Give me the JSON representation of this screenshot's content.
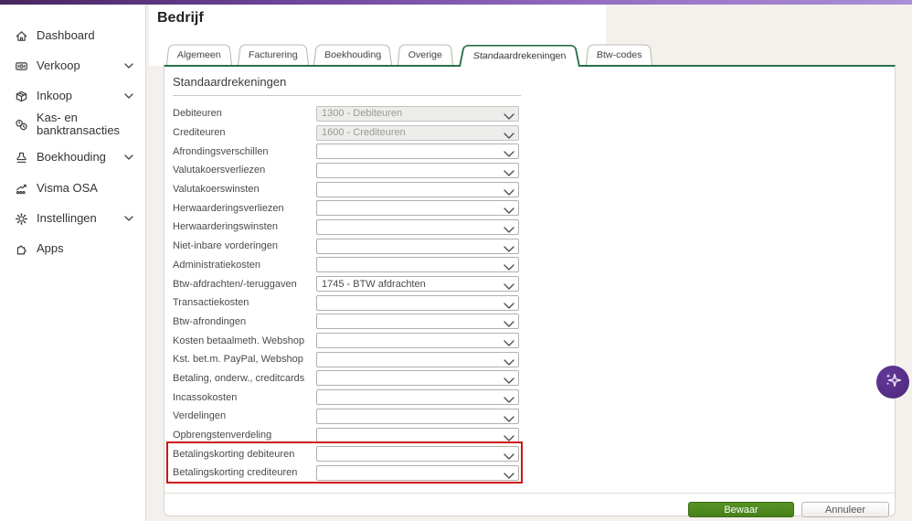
{
  "colors": {
    "topbar_gradient_start": "#46265f",
    "topbar_gradient_end": "#a98fd6",
    "tab_active_green": "#2a7049",
    "save_button_green": "#4c8a1d",
    "highlight_red": "#ce1418",
    "fab_purple": "#552c85"
  },
  "sidebar": {
    "items": [
      {
        "key": "dashboard",
        "label": "Dashboard",
        "icon": "home-icon",
        "chevron": false,
        "two_line": false
      },
      {
        "key": "verkoop",
        "label": "Verkoop",
        "icon": "banknote-icon",
        "chevron": true,
        "two_line": false
      },
      {
        "key": "inkoop",
        "label": "Inkoop",
        "icon": "package-icon",
        "chevron": true,
        "two_line": false
      },
      {
        "key": "kas-en-banktransacties",
        "label": "Kas- en banktransacties",
        "icon": "coins-icon",
        "chevron": false,
        "two_line": true
      },
      {
        "key": "boekhouding",
        "label": "Boekhouding",
        "icon": "stamp-icon",
        "chevron": true,
        "two_line": false
      },
      {
        "key": "visma-osa",
        "label": "Visma OSA",
        "icon": "chart-icon",
        "chevron": false,
        "two_line": false
      },
      {
        "key": "instellingen",
        "label": "Instellingen",
        "icon": "gear-icon",
        "chevron": true,
        "two_line": false
      },
      {
        "key": "apps",
        "label": "Apps",
        "icon": "puzzle-icon",
        "chevron": false,
        "two_line": false
      }
    ]
  },
  "header": {
    "title": "Bedrijf"
  },
  "tabs": [
    {
      "key": "algemeen",
      "label": "Algemeen",
      "active": false
    },
    {
      "key": "facturering",
      "label": "Facturering",
      "active": false
    },
    {
      "key": "boekhouding",
      "label": "Boekhouding",
      "active": false
    },
    {
      "key": "overige",
      "label": "Overige",
      "active": false
    },
    {
      "key": "standaardrekeningen",
      "label": "Standaardrekeningen",
      "active": true
    },
    {
      "key": "btw-codes",
      "label": "Btw-codes",
      "active": false
    }
  ],
  "panel": {
    "section_title": "Standaardrekeningen",
    "fields": [
      {
        "label": "Debiteuren",
        "value": "1300 - Debiteuren",
        "disabled": true,
        "highlighted": false
      },
      {
        "label": "Crediteuren",
        "value": "1600 - Crediteuren",
        "disabled": true,
        "highlighted": false
      },
      {
        "label": "Afrondingsverschillen",
        "value": "",
        "disabled": false,
        "highlighted": false
      },
      {
        "label": "Valutakoersverliezen",
        "value": "",
        "disabled": false,
        "highlighted": false
      },
      {
        "label": "Valutakoerswinsten",
        "value": "",
        "disabled": false,
        "highlighted": false
      },
      {
        "label": "Herwaarderingsverliezen",
        "value": "",
        "disabled": false,
        "highlighted": false
      },
      {
        "label": "Herwaarderingswinsten",
        "value": "",
        "disabled": false,
        "highlighted": false
      },
      {
        "label": "Niet-inbare vorderingen",
        "value": "",
        "disabled": false,
        "highlighted": false
      },
      {
        "label": "Administratiekosten",
        "value": "",
        "disabled": false,
        "highlighted": false
      },
      {
        "label": "Btw-afdrachten/-teruggaven",
        "value": "1745 - BTW afdrachten",
        "disabled": false,
        "highlighted": false
      },
      {
        "label": "Transactiekosten",
        "value": "",
        "disabled": false,
        "highlighted": false
      },
      {
        "label": "Btw-afrondingen",
        "value": "",
        "disabled": false,
        "highlighted": false
      },
      {
        "label": "Kosten betaalmeth. Webshop",
        "value": "",
        "disabled": false,
        "highlighted": false
      },
      {
        "label": "Kst. bet.m. PayPal, Webshop",
        "value": "",
        "disabled": false,
        "highlighted": false
      },
      {
        "label": "Betaling, onderw., creditcards",
        "value": "",
        "disabled": false,
        "highlighted": false
      },
      {
        "label": "Incassokosten",
        "value": "",
        "disabled": false,
        "highlighted": false
      },
      {
        "label": "Verdelingen",
        "value": "",
        "disabled": false,
        "highlighted": false
      },
      {
        "label": "Opbrengstenverdeling",
        "value": "",
        "disabled": false,
        "highlighted": false
      },
      {
        "label": "Betalingskorting debiteuren",
        "value": "",
        "disabled": false,
        "highlighted": true
      },
      {
        "label": "Betalingskorting crediteuren",
        "value": "",
        "disabled": false,
        "highlighted": true
      }
    ]
  },
  "footer": {
    "save_label": "Bewaar",
    "cancel_label": "Annuleer"
  },
  "fab": {
    "icon": "sparkles-icon"
  }
}
